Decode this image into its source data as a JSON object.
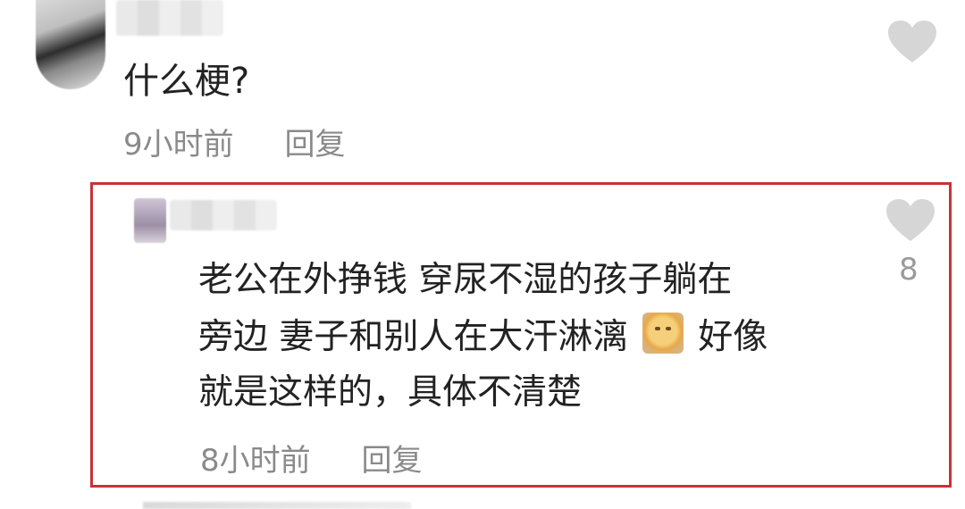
{
  "comments": [
    {
      "text": "什么梗?",
      "time": "9小时前",
      "reply_label": "回复"
    },
    {
      "text_line1": "老公在外挣钱 穿尿不湿的孩子躺在",
      "text_line2_a": "旁边 妻子和别人在大汗淋漓",
      "text_line2_b": "好像",
      "text_line3": "就是这样的，具体不清楚",
      "emoji": "sweat-emoji",
      "like_count": "8",
      "time": "8小时前",
      "reply_label": "回复"
    }
  ],
  "colors": {
    "highlight_border": "#c73337",
    "meta_text": "#8a8a8a",
    "body_text": "#222222",
    "heart": "#d6d6d6"
  }
}
